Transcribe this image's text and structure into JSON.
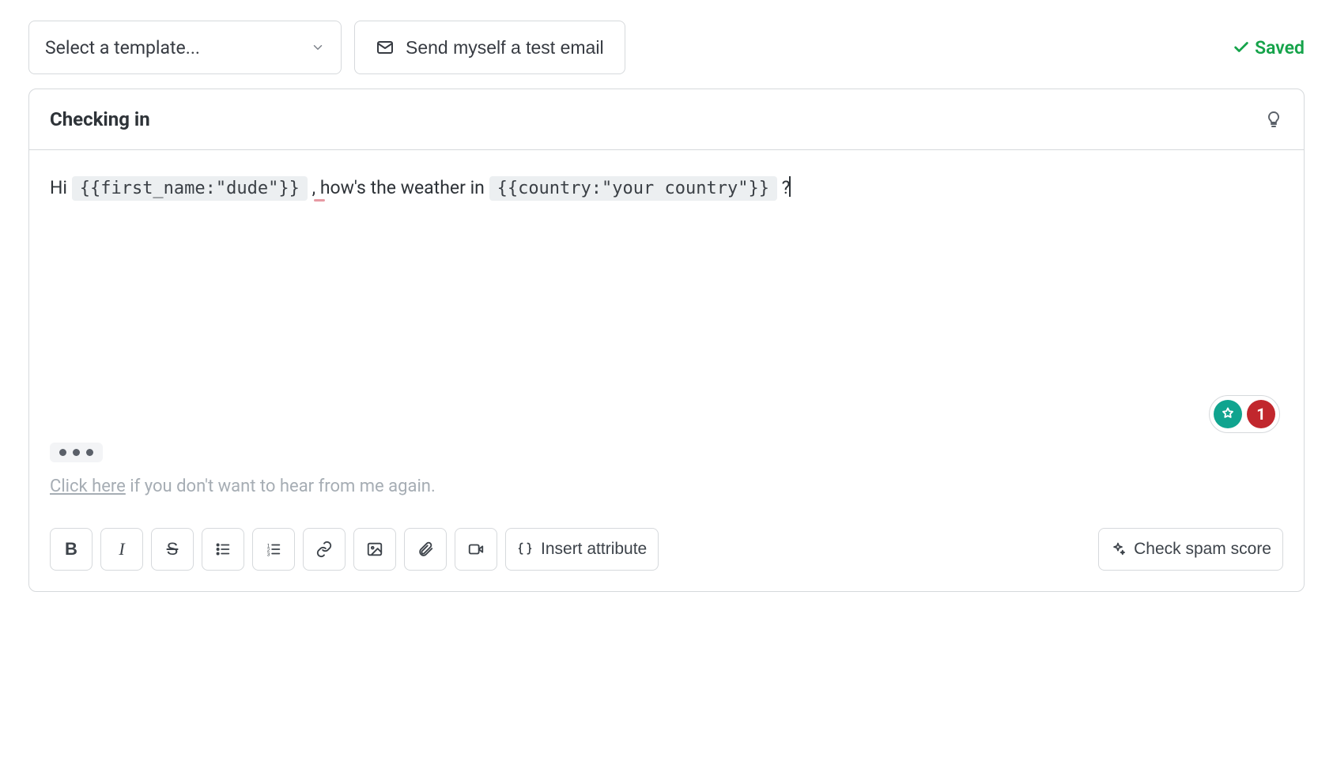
{
  "top": {
    "template_placeholder": "Select a template...",
    "send_test_label": "Send myself a test email",
    "saved_label": "Saved"
  },
  "subject": "Checking in",
  "body": {
    "pre1": "Hi ",
    "token1": "{{first_name:\"dude\"}}",
    "mid1_comma": " ,",
    "mid1_rest": " how's the weather in ",
    "token2": "{{country:\"your country\"}}",
    "tail": " ?"
  },
  "unsubscribe": {
    "link_text": "Click here",
    "rest": " if you don't want to hear from me again."
  },
  "toolbar": {
    "insert_attribute_label": "Insert attribute",
    "check_spam_label": "Check spam score"
  },
  "badges": {
    "red_count": "1"
  }
}
